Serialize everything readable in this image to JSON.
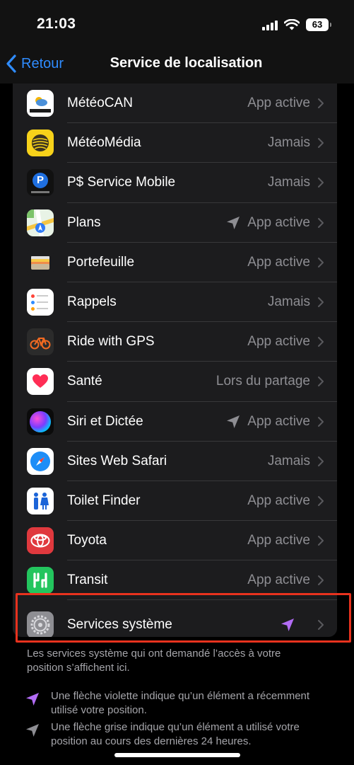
{
  "status_bar": {
    "time": "21:03",
    "battery": "63"
  },
  "nav": {
    "back_label": "Retour",
    "title": "Service de localisation"
  },
  "apps": [
    {
      "name": "MétéoCAN",
      "status": "App active",
      "arrow": "none",
      "icon": "meteocan-icon"
    },
    {
      "name": "MétéoMédia",
      "status": "Jamais",
      "arrow": "none",
      "icon": "meteomedia-icon"
    },
    {
      "name": "P$ Service Mobile",
      "status": "Jamais",
      "arrow": "none",
      "icon": "p-service-mobile-icon"
    },
    {
      "name": "Plans",
      "status": "App active",
      "arrow": "gray",
      "icon": "maps-icon"
    },
    {
      "name": "Portefeuille",
      "status": "App active",
      "arrow": "none",
      "icon": "wallet-icon"
    },
    {
      "name": "Rappels",
      "status": "Jamais",
      "arrow": "none",
      "icon": "reminders-icon"
    },
    {
      "name": "Ride with GPS",
      "status": "App active",
      "arrow": "none",
      "icon": "ride-with-gps-icon"
    },
    {
      "name": "Santé",
      "status": "Lors du partage",
      "arrow": "none",
      "icon": "health-icon"
    },
    {
      "name": "Siri et Dictée",
      "status": "App active",
      "arrow": "gray",
      "icon": "siri-icon"
    },
    {
      "name": "Sites Web Safari",
      "status": "Jamais",
      "arrow": "none",
      "icon": "safari-icon"
    },
    {
      "name": "Toilet Finder",
      "status": "App active",
      "arrow": "none",
      "icon": "toilet-finder-icon"
    },
    {
      "name": "Toyota",
      "status": "App active",
      "arrow": "none",
      "icon": "toyota-icon"
    },
    {
      "name": "Transit",
      "status": "App active",
      "arrow": "none",
      "icon": "transit-icon"
    },
    {
      "name": "Services système",
      "status": "",
      "arrow": "purple",
      "icon": "gear-icon"
    }
  ],
  "footer": {
    "system_note": "Les services système qui ont demandé l’accès à votre position s’affichent ici.",
    "purple_note": "Une flèche violette indique qu’un élément a récemment utilisé votre position.",
    "gray_note": "Une flèche grise indique qu’un élément a utilisé votre position au cours des dernières 24 heures."
  },
  "colors": {
    "accent_blue": "#2f8cff",
    "purple_arrow": "#b26cf5",
    "gray_arrow": "#8e8e93",
    "highlight_border": "#e8321e",
    "card_bg": "#1c1c1e"
  },
  "icons": {
    "purple_arrow": "location-arrow-purple-icon",
    "gray_arrow": "location-arrow-gray-icon",
    "chevron": "chevron-right-icon",
    "back": "chevron-left-icon"
  }
}
